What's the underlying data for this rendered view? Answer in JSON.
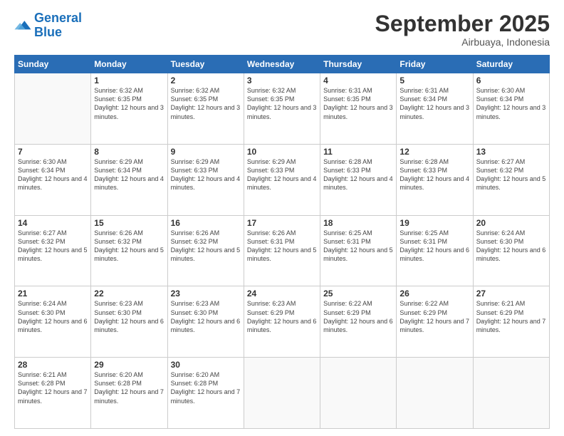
{
  "logo": {
    "line1": "General",
    "line2": "Blue"
  },
  "header": {
    "month": "September 2025",
    "location": "Airbuaya, Indonesia"
  },
  "weekdays": [
    "Sunday",
    "Monday",
    "Tuesday",
    "Wednesday",
    "Thursday",
    "Friday",
    "Saturday"
  ],
  "weeks": [
    [
      {
        "day": "",
        "empty": true
      },
      {
        "day": "1",
        "sunrise": "6:32 AM",
        "sunset": "6:35 PM",
        "daylight": "12 hours and 3 minutes."
      },
      {
        "day": "2",
        "sunrise": "6:32 AM",
        "sunset": "6:35 PM",
        "daylight": "12 hours and 3 minutes."
      },
      {
        "day": "3",
        "sunrise": "6:32 AM",
        "sunset": "6:35 PM",
        "daylight": "12 hours and 3 minutes."
      },
      {
        "day": "4",
        "sunrise": "6:31 AM",
        "sunset": "6:35 PM",
        "daylight": "12 hours and 3 minutes."
      },
      {
        "day": "5",
        "sunrise": "6:31 AM",
        "sunset": "6:34 PM",
        "daylight": "12 hours and 3 minutes."
      },
      {
        "day": "6",
        "sunrise": "6:30 AM",
        "sunset": "6:34 PM",
        "daylight": "12 hours and 3 minutes."
      }
    ],
    [
      {
        "day": "7",
        "sunrise": "6:30 AM",
        "sunset": "6:34 PM",
        "daylight": "12 hours and 4 minutes."
      },
      {
        "day": "8",
        "sunrise": "6:29 AM",
        "sunset": "6:34 PM",
        "daylight": "12 hours and 4 minutes."
      },
      {
        "day": "9",
        "sunrise": "6:29 AM",
        "sunset": "6:33 PM",
        "daylight": "12 hours and 4 minutes."
      },
      {
        "day": "10",
        "sunrise": "6:29 AM",
        "sunset": "6:33 PM",
        "daylight": "12 hours and 4 minutes."
      },
      {
        "day": "11",
        "sunrise": "6:28 AM",
        "sunset": "6:33 PM",
        "daylight": "12 hours and 4 minutes."
      },
      {
        "day": "12",
        "sunrise": "6:28 AM",
        "sunset": "6:33 PM",
        "daylight": "12 hours and 4 minutes."
      },
      {
        "day": "13",
        "sunrise": "6:27 AM",
        "sunset": "6:32 PM",
        "daylight": "12 hours and 5 minutes."
      }
    ],
    [
      {
        "day": "14",
        "sunrise": "6:27 AM",
        "sunset": "6:32 PM",
        "daylight": "12 hours and 5 minutes."
      },
      {
        "day": "15",
        "sunrise": "6:26 AM",
        "sunset": "6:32 PM",
        "daylight": "12 hours and 5 minutes."
      },
      {
        "day": "16",
        "sunrise": "6:26 AM",
        "sunset": "6:32 PM",
        "daylight": "12 hours and 5 minutes."
      },
      {
        "day": "17",
        "sunrise": "6:26 AM",
        "sunset": "6:31 PM",
        "daylight": "12 hours and 5 minutes."
      },
      {
        "day": "18",
        "sunrise": "6:25 AM",
        "sunset": "6:31 PM",
        "daylight": "12 hours and 5 minutes."
      },
      {
        "day": "19",
        "sunrise": "6:25 AM",
        "sunset": "6:31 PM",
        "daylight": "12 hours and 6 minutes."
      },
      {
        "day": "20",
        "sunrise": "6:24 AM",
        "sunset": "6:30 PM",
        "daylight": "12 hours and 6 minutes."
      }
    ],
    [
      {
        "day": "21",
        "sunrise": "6:24 AM",
        "sunset": "6:30 PM",
        "daylight": "12 hours and 6 minutes."
      },
      {
        "day": "22",
        "sunrise": "6:23 AM",
        "sunset": "6:30 PM",
        "daylight": "12 hours and 6 minutes."
      },
      {
        "day": "23",
        "sunrise": "6:23 AM",
        "sunset": "6:30 PM",
        "daylight": "12 hours and 6 minutes."
      },
      {
        "day": "24",
        "sunrise": "6:23 AM",
        "sunset": "6:29 PM",
        "daylight": "12 hours and 6 minutes."
      },
      {
        "day": "25",
        "sunrise": "6:22 AM",
        "sunset": "6:29 PM",
        "daylight": "12 hours and 6 minutes."
      },
      {
        "day": "26",
        "sunrise": "6:22 AM",
        "sunset": "6:29 PM",
        "daylight": "12 hours and 7 minutes."
      },
      {
        "day": "27",
        "sunrise": "6:21 AM",
        "sunset": "6:29 PM",
        "daylight": "12 hours and 7 minutes."
      }
    ],
    [
      {
        "day": "28",
        "sunrise": "6:21 AM",
        "sunset": "6:28 PM",
        "daylight": "12 hours and 7 minutes."
      },
      {
        "day": "29",
        "sunrise": "6:20 AM",
        "sunset": "6:28 PM",
        "daylight": "12 hours and 7 minutes."
      },
      {
        "day": "30",
        "sunrise": "6:20 AM",
        "sunset": "6:28 PM",
        "daylight": "12 hours and 7 minutes."
      },
      {
        "day": "",
        "empty": true
      },
      {
        "day": "",
        "empty": true
      },
      {
        "day": "",
        "empty": true
      },
      {
        "day": "",
        "empty": true
      }
    ]
  ]
}
